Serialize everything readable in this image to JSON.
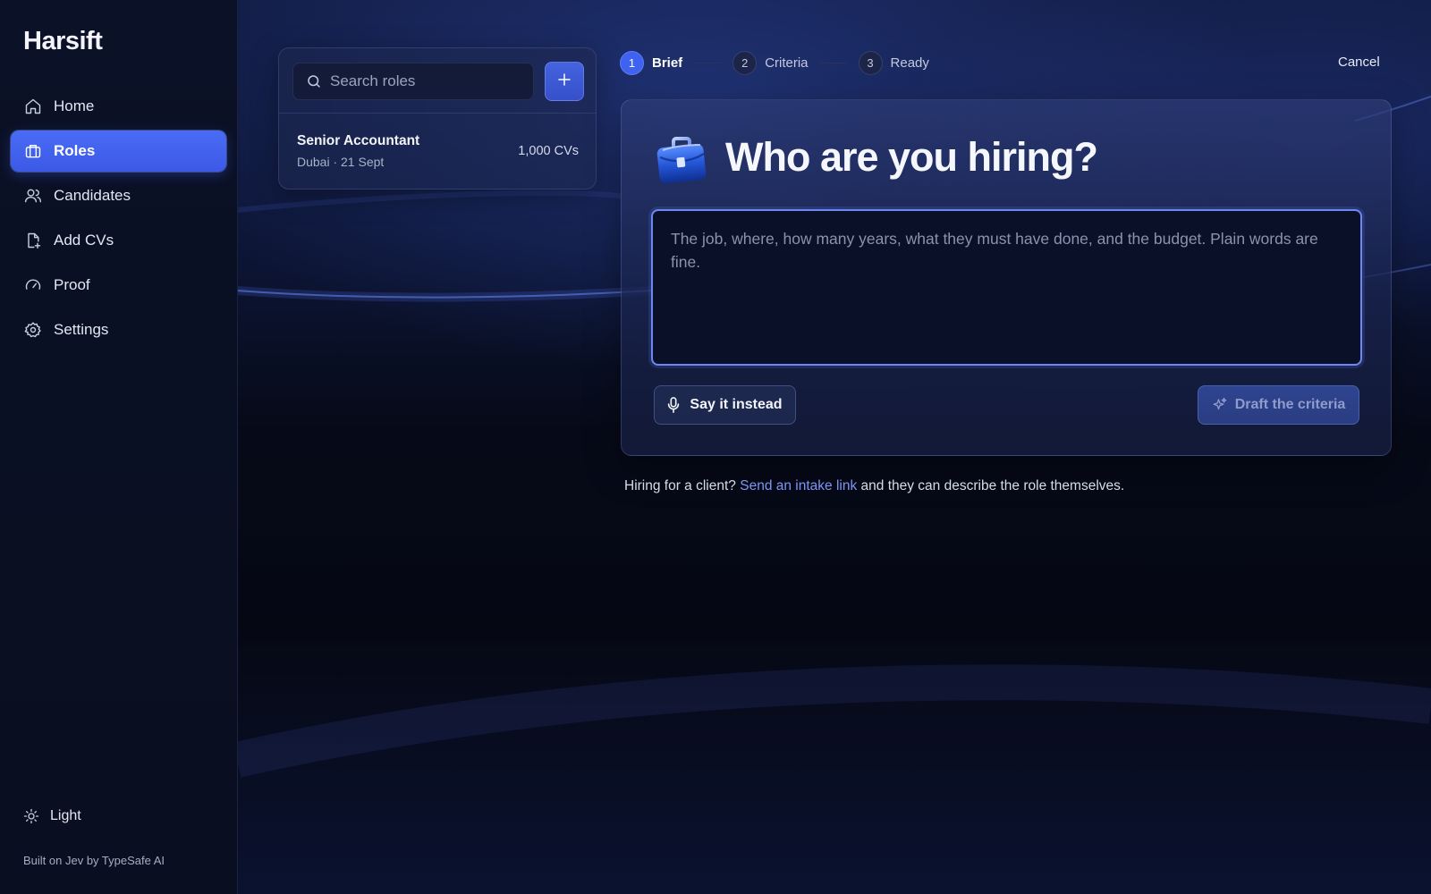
{
  "app": {
    "name": "Harsift"
  },
  "sidebar": {
    "items": [
      {
        "label": "Home",
        "icon": "home-icon"
      },
      {
        "label": "Roles",
        "icon": "briefcase-icon",
        "active": true
      },
      {
        "label": "Candidates",
        "icon": "users-icon"
      },
      {
        "label": "Add CVs",
        "icon": "file-add-icon"
      },
      {
        "label": "Proof",
        "icon": "gauge-icon"
      },
      {
        "label": "Settings",
        "icon": "gear-icon"
      }
    ],
    "theme_toggle": "Light",
    "footer": "Built on Jev by TypeSafe AI"
  },
  "roles_panel": {
    "search_placeholder": "Search roles",
    "roles": [
      {
        "title": "Senior Accountant",
        "meta": "Dubai · 21 Sept",
        "count": "1,000 CVs"
      }
    ]
  },
  "stepper": {
    "steps": [
      {
        "num": "1",
        "label": "Brief",
        "active": true
      },
      {
        "num": "2",
        "label": "Criteria"
      },
      {
        "num": "3",
        "label": "Ready"
      }
    ],
    "cancel": "Cancel"
  },
  "brief_card": {
    "icon": "briefcase-icon",
    "title": "Who are you hiring?",
    "placeholder": "The job, where, how many years, what they must have done, and the budget. Plain words are fine.",
    "voice_button": "Say it instead",
    "draft_button": "Draft the criteria"
  },
  "client_note": {
    "prefix": "Hiring for a client?",
    "link": "Send an intake link",
    "suffix": "and they can describe the role themselves."
  },
  "colors": {
    "accent": "#3f62f0",
    "link": "#7f95f3",
    "background": "#060a17"
  }
}
